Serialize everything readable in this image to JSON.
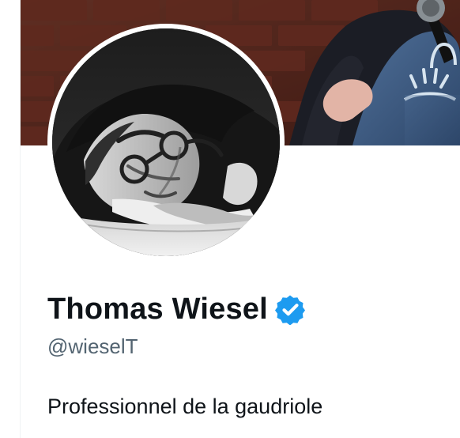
{
  "profile": {
    "name": "Thomas Wiesel",
    "handle": "@wieselT",
    "bio": "Professionnel de la gaudriole",
    "verified": true
  },
  "icons": {
    "verified": "verified-badge-icon"
  },
  "colors": {
    "verified_blue": "#1d9bf0",
    "name_text": "#0f1419",
    "secondary_text": "#536471",
    "background": "#ffffff"
  }
}
